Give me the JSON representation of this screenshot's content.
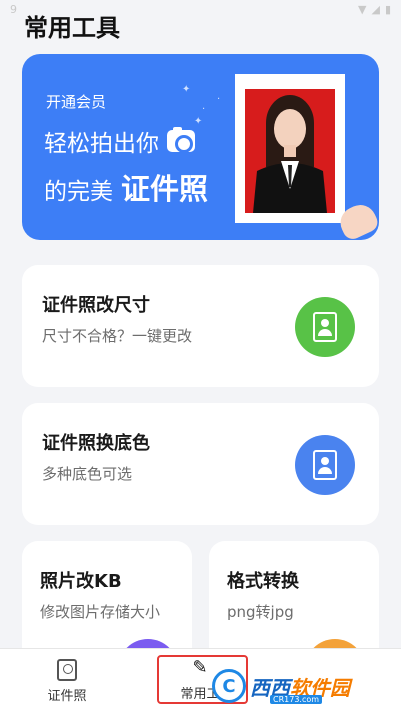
{
  "status_bar": {
    "time": "9",
    "wifi_icon": "wifi-icon",
    "signal_icon": "signal-icon",
    "battery_icon": "battery-icon"
  },
  "page": {
    "title": "常用工具"
  },
  "banner": {
    "small_text": "开通会员",
    "line1": "轻松拍出你",
    "line2_prefix": "的完美",
    "line2_strong": "证件照",
    "accent": "#3d7ef6"
  },
  "tools": [
    {
      "title": "证件照改尺寸",
      "subtitle": "尺寸不合格？一键更改",
      "icon": "id-photo-icon",
      "icon_color": "#58c247"
    },
    {
      "title": "证件照换底色",
      "subtitle": "多种底色可选",
      "icon": "id-photo-icon",
      "icon_color": "#4a83ef"
    },
    {
      "title": "照片改KB",
      "subtitle": "修改图片存储大小",
      "icon": "compress-icon",
      "icon_color": "#7b5cf0"
    },
    {
      "title": "格式转换",
      "subtitle": "png转jpg",
      "icon": "convert-icon",
      "icon_color": "#f3a23a"
    }
  ],
  "nav": {
    "items": [
      {
        "label": "证件照",
        "icon": "id-card-icon"
      },
      {
        "label": "常用工",
        "icon": "wrench-icon"
      }
    ]
  },
  "watermark": {
    "logo": "C",
    "text_a": "西西",
    "text_b": "软件园",
    "sub": "CR173.com"
  }
}
